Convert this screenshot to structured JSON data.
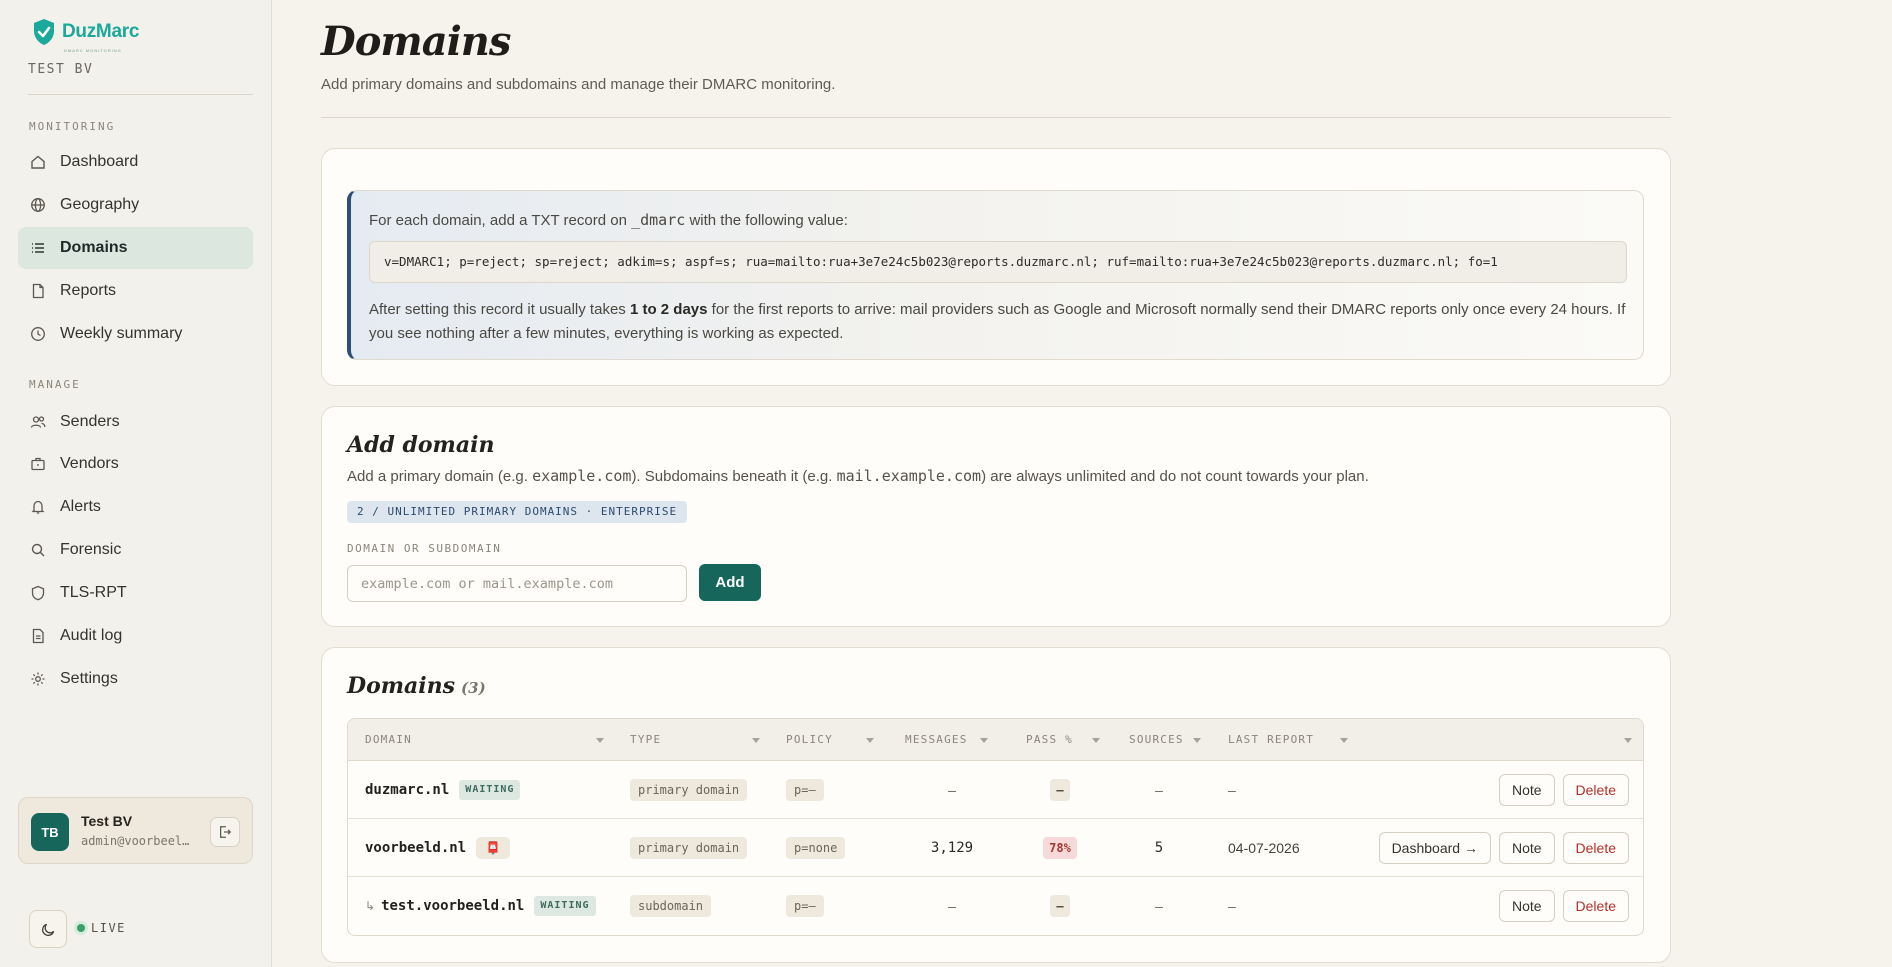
{
  "brand": {
    "name": "DuzMarc",
    "tagline": "DMARC MONITORING",
    "org": "TEST BV",
    "accent": "#16665b"
  },
  "sidebar": {
    "sections": [
      {
        "label": "MONITORING"
      },
      {
        "label": "MANAGE"
      }
    ],
    "items": [
      {
        "label": "Dashboard",
        "icon": "home-icon"
      },
      {
        "label": "Geography",
        "icon": "globe-icon"
      },
      {
        "label": "Domains",
        "icon": "list-icon",
        "active": true
      },
      {
        "label": "Reports",
        "icon": "file-icon"
      },
      {
        "label": "Weekly summary",
        "icon": "clock-icon"
      },
      {
        "label": "Senders",
        "icon": "users-icon"
      },
      {
        "label": "Vendors",
        "icon": "briefcase-icon"
      },
      {
        "label": "Alerts",
        "icon": "bell-icon"
      },
      {
        "label": "Forensic",
        "icon": "search-icon"
      },
      {
        "label": "TLS-RPT",
        "icon": "shield-icon"
      },
      {
        "label": "Audit log",
        "icon": "document-icon"
      },
      {
        "label": "Settings",
        "icon": "gear-icon"
      }
    ],
    "user": {
      "initials": "TB",
      "name": "Test BV",
      "email": "admin@voorbeel…"
    },
    "live_label": "LIVE"
  },
  "page": {
    "title": "Domains",
    "subtitle": "Add primary domains and subdomains and manage their DMARC monitoring."
  },
  "instructions": {
    "line1_pre": "For each domain, add a TXT record on ",
    "line1_code": "_dmarc",
    "line1_post": " with the following value:",
    "record": "v=DMARC1; p=reject; sp=reject; adkim=s; aspf=s; rua=mailto:rua+3e7e24c5b023@reports.duzmarc.nl; ruf=mailto:rua+3e7e24c5b023@reports.duzmarc.nl; fo=1",
    "para_pre": "After setting this record it usually takes ",
    "para_bold": "1 to 2 days",
    "para_post": " for the first reports to arrive: mail providers such as Google and Microsoft normally send their DMARC reports only once every 24 hours. If you see nothing after a few minutes, everything is working as expected."
  },
  "add_domain": {
    "title": "Add domain",
    "desc_1": "Add a primary domain (e.g. ",
    "desc_code1": "example.com",
    "desc_2": "). Subdomains beneath it (e.g. ",
    "desc_code2": "mail.example.com",
    "desc_3": ") are always unlimited and do not count towards your plan.",
    "quota": "2 / UNLIMITED PRIMARY DOMAINS · ENTERPRISE",
    "field_label": "DOMAIN OR SUBDOMAIN",
    "placeholder": "example.com or mail.example.com",
    "value": "",
    "button": "Add"
  },
  "domains": {
    "title": "Domains",
    "count": "(3)",
    "columns": [
      "DOMAIN",
      "TYPE",
      "POLICY",
      "MESSAGES",
      "PASS %",
      "SOURCES",
      "LAST REPORT"
    ],
    "rows": [
      {
        "prefix": "",
        "domain": "duzmarc.nl",
        "badge": "WAITING",
        "badge_kind": "waiting",
        "type": "primary domain",
        "policy": "p=–",
        "messages": "–",
        "pass": "–",
        "pass_kind": "neutral",
        "sources": "–",
        "last_report": "–",
        "dashboard": "",
        "note": "Note",
        "delete": "Delete"
      },
      {
        "prefix": "",
        "domain": "voorbeeld.nl",
        "badge": "📮",
        "badge_kind": "emoji",
        "type": "primary domain",
        "policy": "p=none",
        "messages": "3,129",
        "pass": "78%",
        "pass_kind": "red",
        "sources": "5",
        "last_report": "04-07-2026",
        "dashboard": "Dashboard →",
        "note": "Note",
        "delete": "Delete"
      },
      {
        "prefix": "↳",
        "domain": "test.voorbeeld.nl",
        "badge": "WAITING",
        "badge_kind": "waiting",
        "type": "subdomain",
        "policy": "p=–",
        "messages": "–",
        "pass": "–",
        "pass_kind": "neutral",
        "sources": "–",
        "last_report": "–",
        "dashboard": "",
        "note": "Note",
        "delete": "Delete"
      }
    ]
  }
}
